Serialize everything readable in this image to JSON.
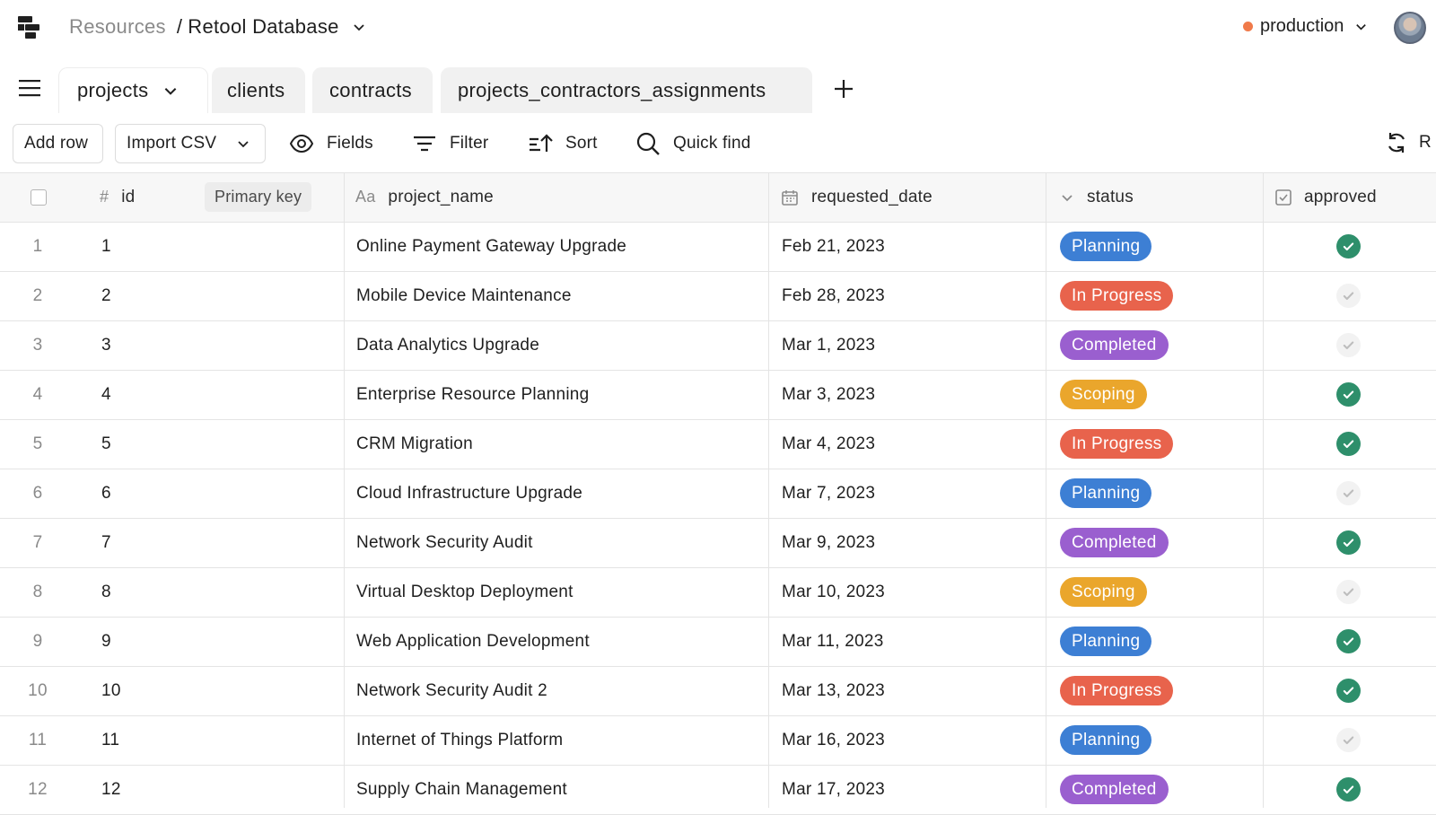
{
  "header": {
    "breadcrumb_parent": "Resources",
    "breadcrumb_separator": "/",
    "breadcrumb_current": "Retool Database",
    "environment": "production",
    "environment_color": "#f07a4a"
  },
  "tabs": [
    {
      "label": "projects",
      "active": true
    },
    {
      "label": "clients",
      "active": false
    },
    {
      "label": "contracts",
      "active": false
    },
    {
      "label": "projects_contractors_assignments",
      "active": false
    }
  ],
  "toolbar": {
    "add_row": "Add row",
    "import_csv": "Import CSV",
    "fields": "Fields",
    "filter": "Filter",
    "sort": "Sort",
    "quick_find": "Quick find",
    "refresh_partial": "R"
  },
  "columns": {
    "id_icon": "#",
    "id": "id",
    "primary_key": "Primary key",
    "project_name_icon": "Aa",
    "project_name": "project_name",
    "requested_date": "requested_date",
    "status": "status",
    "approved": "approved"
  },
  "status_colors": {
    "Planning": "#3d7fd4",
    "In Progress": "#e8634c",
    "Completed": "#9a5fcf",
    "Scoping": "#eaa62c"
  },
  "rows": [
    {
      "rn": "1",
      "id": "1",
      "project_name": "Online Payment Gateway Upgrade",
      "requested_date": "Feb 21, 2023",
      "status": "Planning",
      "approved": true
    },
    {
      "rn": "2",
      "id": "2",
      "project_name": "Mobile Device Maintenance",
      "requested_date": "Feb 28, 2023",
      "status": "In Progress",
      "approved": false
    },
    {
      "rn": "3",
      "id": "3",
      "project_name": "Data Analytics Upgrade",
      "requested_date": "Mar 1, 2023",
      "status": "Completed",
      "approved": false
    },
    {
      "rn": "4",
      "id": "4",
      "project_name": "Enterprise Resource Planning",
      "requested_date": "Mar 3, 2023",
      "status": "Scoping",
      "approved": true
    },
    {
      "rn": "5",
      "id": "5",
      "project_name": "CRM Migration",
      "requested_date": "Mar 4, 2023",
      "status": "In Progress",
      "approved": true
    },
    {
      "rn": "6",
      "id": "6",
      "project_name": "Cloud Infrastructure Upgrade",
      "requested_date": "Mar 7, 2023",
      "status": "Planning",
      "approved": false
    },
    {
      "rn": "7",
      "id": "7",
      "project_name": "Network Security Audit",
      "requested_date": "Mar 9, 2023",
      "status": "Completed",
      "approved": true
    },
    {
      "rn": "8",
      "id": "8",
      "project_name": "Virtual Desktop Deployment",
      "requested_date": "Mar 10, 2023",
      "status": "Scoping",
      "approved": false
    },
    {
      "rn": "9",
      "id": "9",
      "project_name": "Web Application Development",
      "requested_date": "Mar 11, 2023",
      "status": "Planning",
      "approved": true
    },
    {
      "rn": "10",
      "id": "10",
      "project_name": "Network Security Audit 2",
      "requested_date": "Mar 13, 2023",
      "status": "In Progress",
      "approved": true
    },
    {
      "rn": "11",
      "id": "11",
      "project_name": "Internet of Things Platform",
      "requested_date": "Mar 16, 2023",
      "status": "Planning",
      "approved": false
    },
    {
      "rn": "12",
      "id": "12",
      "project_name": "Supply Chain Management",
      "requested_date": "Mar 17, 2023",
      "status": "Completed",
      "approved": true
    }
  ]
}
